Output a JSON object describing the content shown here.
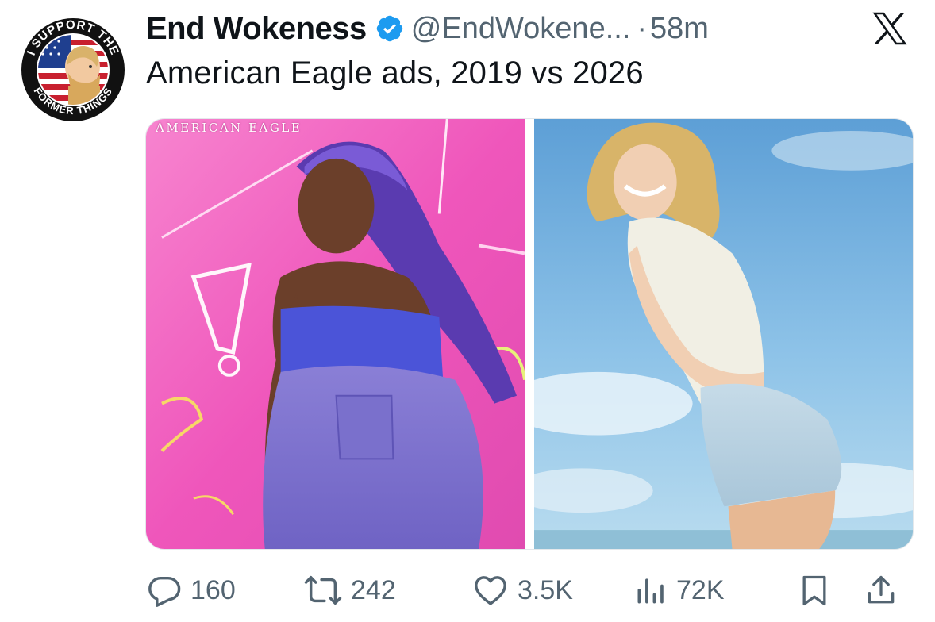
{
  "tweet": {
    "author": {
      "display_name": "End Wokeness",
      "handle": "@EndWokene...",
      "verified": true,
      "avatar": {
        "icon": "avatar-icon",
        "ring_text_top": "I SUPPORT THE",
        "ring_text_bottom": "FORMER THINGS"
      }
    },
    "separator": "·",
    "timestamp": "58m",
    "text": "American Eagle ads, 2019 vs 2026",
    "platform_icon": "x-logo-icon",
    "media": [
      {
        "caption": "AMERICAN EAGLE",
        "icon": "photo-icon"
      },
      {
        "caption": "",
        "icon": "photo-icon"
      }
    ],
    "actions": {
      "reply": {
        "count": "160",
        "icon": "reply-icon"
      },
      "retweet": {
        "count": "242",
        "icon": "retweet-icon"
      },
      "like": {
        "count": "3.5K",
        "icon": "heart-icon"
      },
      "views": {
        "count": "72K",
        "icon": "views-icon"
      },
      "bookmark": {
        "icon": "bookmark-icon"
      },
      "share": {
        "icon": "share-icon"
      }
    }
  },
  "colors": {
    "text_primary": "#0f1419",
    "text_secondary": "#536471",
    "verified_blue": "#1d9bf0",
    "left_photo_bg": "#f05bbf",
    "right_photo_sky": "#7fb7df"
  }
}
